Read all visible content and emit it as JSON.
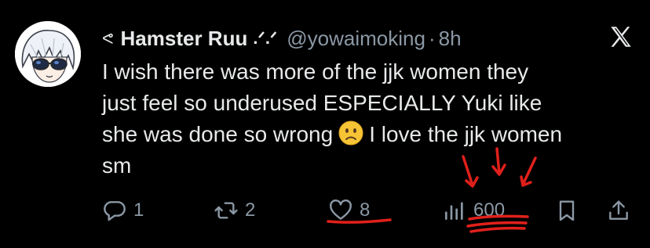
{
  "tweet": {
    "author": {
      "display_name": "Hamster Ruu",
      "name_prefix_glyph": "ᕙ",
      "name_decoration": ".ᐟ.ᐟ",
      "handle": "@yowaimoking",
      "separator": "·",
      "time": "8h"
    },
    "text_lines": [
      "I wish there was more of the jjk women they",
      "just feel so underused ESPECIALLY Yuki like",
      "she was done so wrong",
      "I love the jjk women",
      "sm"
    ],
    "emoji": "slightly-frowning-face",
    "actions": {
      "replies": "1",
      "reposts": "2",
      "likes": "8",
      "views": "600"
    }
  },
  "icons": {
    "platform": "x-logo",
    "reply": "reply-icon",
    "repost": "repost-icon",
    "like": "heart-icon",
    "views": "analytics-icon",
    "bookmark": "bookmark-icon",
    "share": "share-icon"
  },
  "colors": {
    "background": "#000000",
    "text": "#e7e9ea",
    "muted": "#8b98a5",
    "annotation": "#e0201b"
  }
}
